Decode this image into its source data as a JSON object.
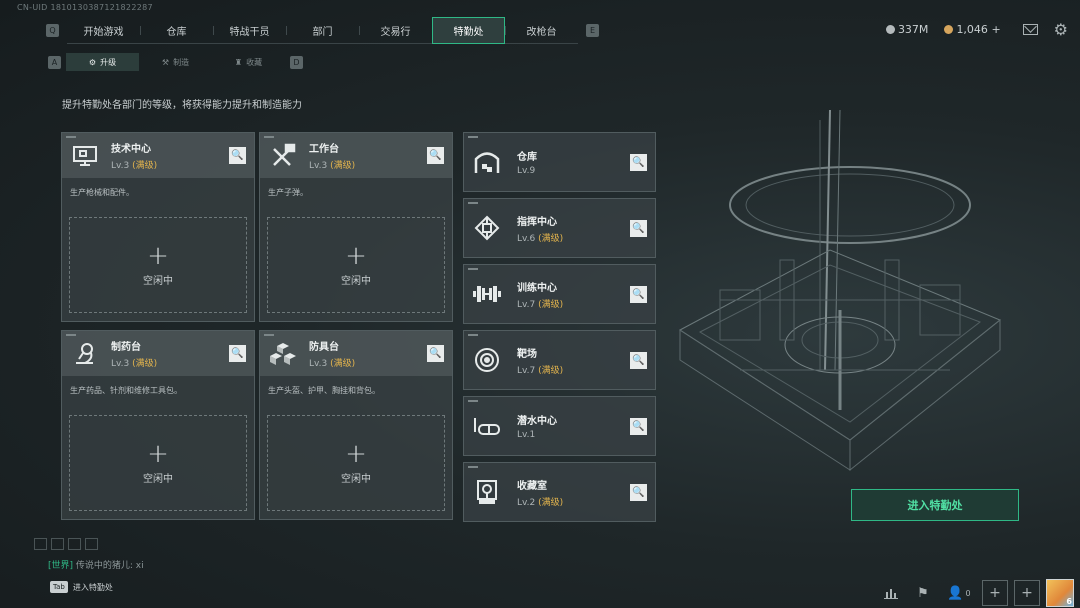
{
  "uid": "CN-UID 1810130387121822287",
  "top_nav": {
    "left_key": "Q",
    "right_key": "E",
    "tabs": [
      {
        "label": "开始游戏",
        "active": false
      },
      {
        "label": "仓库",
        "active": false
      },
      {
        "label": "特战干员",
        "active": false
      },
      {
        "label": "部门",
        "active": false
      },
      {
        "label": "交易行",
        "active": false
      },
      {
        "label": "特勤处",
        "active": true
      },
      {
        "label": "改枪台",
        "active": false
      }
    ]
  },
  "currency": {
    "silver": "337M",
    "gold": "1,046",
    "add": "+"
  },
  "sub_nav": {
    "left_key": "A",
    "right_key": "D",
    "tabs": [
      {
        "label": "升级",
        "icon": "upgrade-icon",
        "active": true
      },
      {
        "label": "制造",
        "icon": "craft-icon",
        "active": false
      },
      {
        "label": "收藏",
        "icon": "collection-icon",
        "active": false
      }
    ]
  },
  "description": "提升特勤处各部门的等级，将获得能力提升和制造能力",
  "work_cards": [
    {
      "name": "技术中心",
      "level": "Lv.3",
      "max": "(满级)",
      "desc": "生产枪械和配件。",
      "slot_plus": "+",
      "slot_status": "空闲中",
      "icon": "computer-icon"
    },
    {
      "name": "工作台",
      "level": "Lv.3",
      "max": "(满级)",
      "desc": "生产子弹。",
      "slot_plus": "+",
      "slot_status": "空闲中",
      "icon": "tools-icon"
    },
    {
      "name": "制药台",
      "level": "Lv.3",
      "max": "(满级)",
      "desc": "生产药品、针剂和维修工具包。",
      "slot_plus": "+",
      "slot_status": "空闲中",
      "icon": "microscope-icon"
    },
    {
      "name": "防具台",
      "level": "Lv.3",
      "max": "(满级)",
      "desc": "生产头盔、护甲、胸挂和背包。",
      "slot_plus": "+",
      "slot_status": "空闲中",
      "icon": "cubes-icon"
    }
  ],
  "departments": [
    {
      "name": "仓库",
      "level": "Lv.9",
      "max": "",
      "icon": "warehouse-icon"
    },
    {
      "name": "指挥中心",
      "level": "Lv.6",
      "max": "(满级)",
      "icon": "chip-icon"
    },
    {
      "name": "训练中心",
      "level": "Lv.7",
      "max": "(满级)",
      "icon": "dumbbell-icon"
    },
    {
      "name": "靶场",
      "level": "Lv.7",
      "max": "(满级)",
      "icon": "target-icon"
    },
    {
      "name": "潜水中心",
      "level": "Lv.1",
      "max": "",
      "icon": "dive-mask-icon"
    },
    {
      "name": "收藏室",
      "level": "Lv.2",
      "max": "(满级)",
      "icon": "trophy-icon"
    }
  ],
  "enter_button": "进入特勤处",
  "chat": {
    "channel": "[世界]",
    "message": "传说中的猪儿: xi"
  },
  "tab_hint": {
    "key": "Tab",
    "label": "进入特勤处"
  },
  "bottom_bar": {
    "friends_count": "0",
    "avatar_badge": "6"
  },
  "colors": {
    "accent": "#2fb886",
    "max_level": "#e3b44d",
    "background": "#1a2123"
  }
}
